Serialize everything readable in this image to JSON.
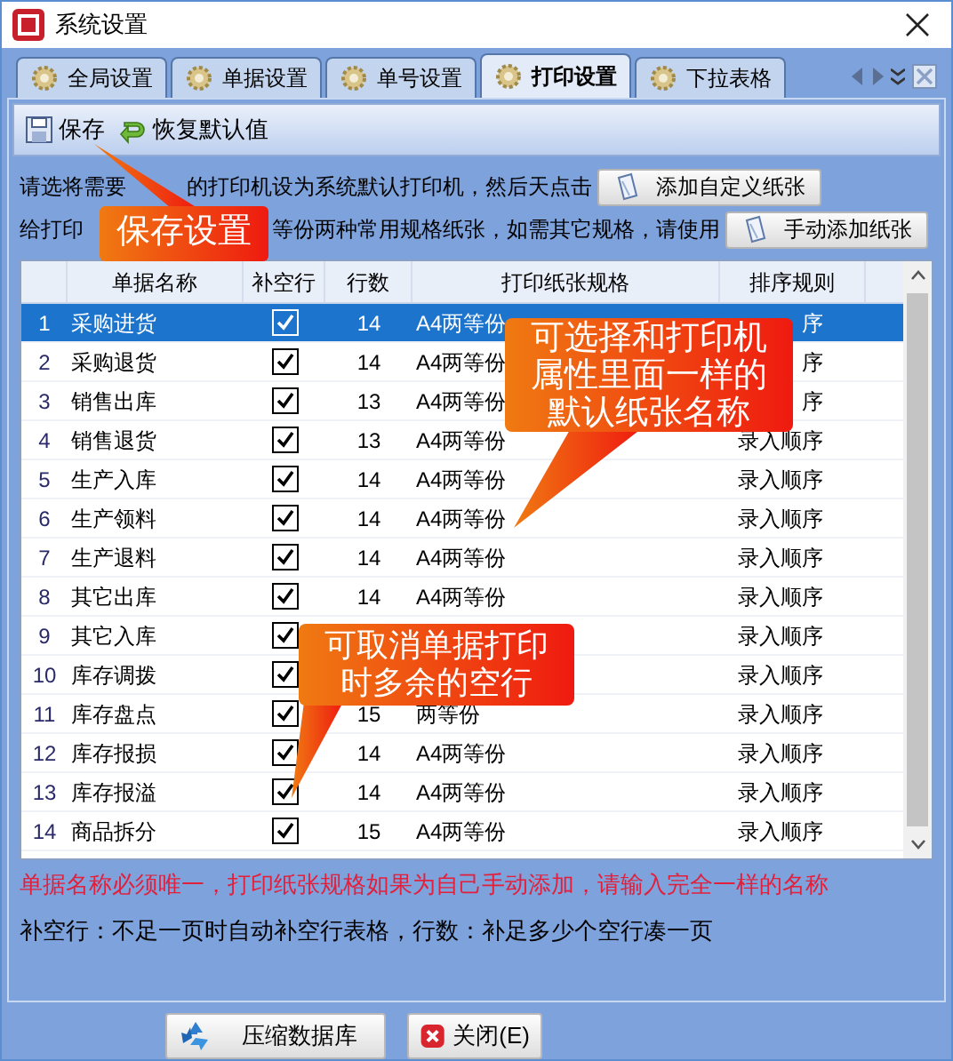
{
  "window": {
    "title": "系统设置"
  },
  "tabs": [
    {
      "label": "全局设置",
      "selected": false
    },
    {
      "label": "单据设置",
      "selected": false
    },
    {
      "label": "单号设置",
      "selected": false
    },
    {
      "label": "打印设置",
      "selected": true
    },
    {
      "label": "下拉表格",
      "selected": false
    }
  ],
  "toolbar": [
    {
      "label": "保存",
      "kind": "save"
    },
    {
      "label": "恢复默认值",
      "kind": "restore"
    }
  ],
  "instructions": [
    {
      "parts": [
        "请选将需要",
        "的打印机设为系统默认打印机，然后天点击"
      ],
      "button": "添加自定义纸张"
    },
    {
      "parts": [
        "给打印",
        "等份两种常用规格纸张，如需其它规格，请使用"
      ],
      "button": "手动添加纸张"
    }
  ],
  "table": {
    "columns": [
      "单据名称",
      "补空行",
      "行数",
      "打印纸张规格",
      "排序规则"
    ],
    "rows": [
      {
        "index": "1",
        "name": "采购进货",
        "fill_blank": true,
        "count": "14",
        "paper": "A4两等份",
        "sort": "序",
        "selected": true
      },
      {
        "index": "2",
        "name": "采购退货",
        "fill_blank": true,
        "count": "14",
        "paper": "A4两等份",
        "sort": "序",
        "selected": false
      },
      {
        "index": "3",
        "name": "销售出库",
        "fill_blank": true,
        "count": "13",
        "paper": "A4两等份",
        "sort": "序",
        "selected": false
      },
      {
        "index": "4",
        "name": "销售退货",
        "fill_blank": true,
        "count": "13",
        "paper": "A4两等份",
        "sort": "录入顺序",
        "selected": false
      },
      {
        "index": "5",
        "name": "生产入库",
        "fill_blank": true,
        "count": "14",
        "paper": "A4两等份",
        "sort": "录入顺序",
        "selected": false
      },
      {
        "index": "6",
        "name": "生产领料",
        "fill_blank": true,
        "count": "14",
        "paper": "A4两等份",
        "sort": "录入顺序",
        "selected": false
      },
      {
        "index": "7",
        "name": "生产退料",
        "fill_blank": true,
        "count": "14",
        "paper": "A4两等份",
        "sort": "录入顺序",
        "selected": false
      },
      {
        "index": "8",
        "name": "其它出库",
        "fill_blank": true,
        "count": "14",
        "paper": "A4两等份",
        "sort": "录入顺序",
        "selected": false
      },
      {
        "index": "9",
        "name": "其它入库",
        "fill_blank": true,
        "sort": "录入顺序",
        "selected": false
      },
      {
        "index": "10",
        "name": "库存调拨",
        "fill_blank": true,
        "sort": "录入顺序",
        "selected": false
      },
      {
        "index": "11",
        "name": "库存盘点",
        "fill_blank": true,
        "count": "15",
        "paper": "两等份",
        "sort": "录入顺序",
        "selected": false
      },
      {
        "index": "12",
        "name": "库存报损",
        "fill_blank": true,
        "count": "14",
        "paper": "A4两等份",
        "sort": "录入顺序",
        "selected": false
      },
      {
        "index": "13",
        "name": "库存报溢",
        "fill_blank": true,
        "count": "14",
        "paper": "A4两等份",
        "sort": "录入顺序",
        "selected": false
      },
      {
        "index": "14",
        "name": "商品拆分",
        "fill_blank": true,
        "count": "15",
        "paper": "A4两等份",
        "sort": "录入顺序",
        "selected": false
      }
    ]
  },
  "notes": [
    {
      "text": "单据名称必须唯一，打印纸张规格如果为自己手动添加，请输入完全一样的名称",
      "kind": "warning"
    },
    {
      "text": "补空行：不足一页时自动补空行表格，行数：补足多少个空行凑一页",
      "kind": "info"
    }
  ],
  "buttons": [
    {
      "label": "压缩数据库",
      "kind": "compress"
    },
    {
      "label": "关闭(E)",
      "kind": "close"
    }
  ],
  "callouts": [
    {
      "text": "保存设置"
    },
    {
      "text": "可选择和打印机属性里面一样的默认纸张名称"
    },
    {
      "text": "可取消单据打印时多余的空行"
    }
  ]
}
